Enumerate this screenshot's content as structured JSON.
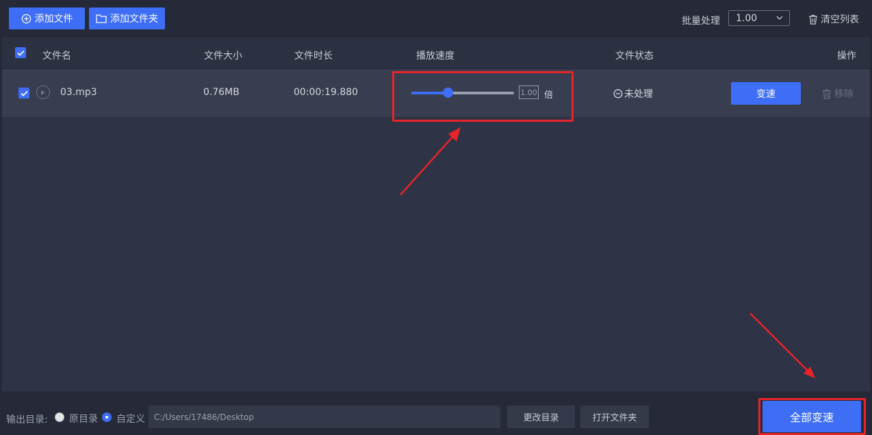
{
  "toolbar": {
    "add_file_label": "添加文件",
    "add_folder_label": "添加文件夹",
    "batch_label": "批量处理",
    "batch_value": "1.00",
    "clear_list_label": "清空列表"
  },
  "table": {
    "headers": {
      "name": "文件名",
      "size": "文件大小",
      "duration": "文件时长",
      "speed": "播放速度",
      "status": "文件状态",
      "action": "操作"
    },
    "rows": [
      {
        "name": "03.mp3",
        "size": "0.76MB",
        "duration": "00:00:19.880",
        "speed_value": "1.00",
        "speed_unit": "倍",
        "slider_fraction": 0.35,
        "status": "未处理",
        "convert_label": "变速",
        "remove_label": "移除"
      }
    ]
  },
  "footer": {
    "output_label": "输出目录:",
    "option_original": "原目录",
    "option_custom": "自定义",
    "selected_option": "自定义",
    "path_value": "C:/Users/17486/Desktop",
    "change_dir_label": "更改目录",
    "open_folder_label": "打开文件夹",
    "convert_all_label": "全部变速"
  },
  "colors": {
    "accent": "#3d6ef5",
    "highlight": "#e8242a",
    "background": "#262a38"
  }
}
